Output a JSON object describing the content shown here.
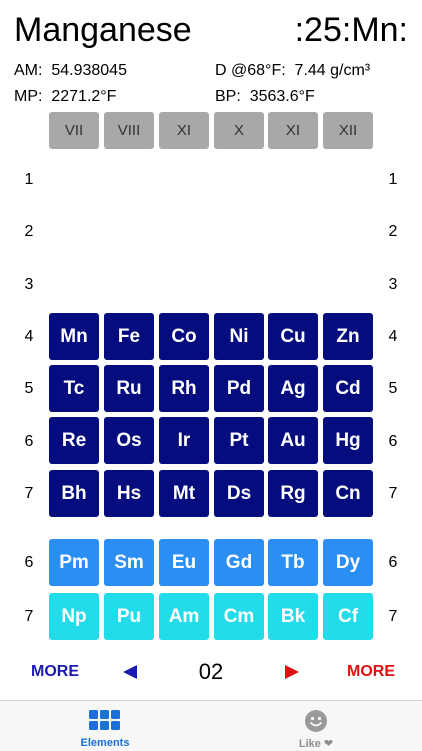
{
  "element": {
    "name": "Manganese",
    "symbol_display": ":25:Mn:",
    "am_label": "AM:",
    "am_value": "54.938045",
    "density_label": "D @68°F:",
    "density_value": "7.44 g/cm³",
    "mp_label": "MP:",
    "mp_value": "2271.2°F",
    "bp_label": "BP:",
    "bp_value": "3563.6°F"
  },
  "groups": [
    "VII",
    "VIII",
    "XI",
    "X",
    "XI",
    "XII"
  ],
  "periods": [
    "1",
    "2",
    "3",
    "4",
    "5",
    "6",
    "7"
  ],
  "lower_periods": [
    "6",
    "7"
  ],
  "main_rows": [
    [
      "Mn",
      "Fe",
      "Co",
      "Ni",
      "Cu",
      "Zn"
    ],
    [
      "Tc",
      "Ru",
      "Rh",
      "Pd",
      "Ag",
      "Cd"
    ],
    [
      "Re",
      "Os",
      "Ir",
      "Pt",
      "Au",
      "Hg"
    ],
    [
      "Bh",
      "Hs",
      "Mt",
      "Ds",
      "Rg",
      "Cn"
    ]
  ],
  "lanthanides": [
    "Pm",
    "Sm",
    "Eu",
    "Gd",
    "Tb",
    "Dy"
  ],
  "actinides": [
    "Np",
    "Pu",
    "Am",
    "Cm",
    "Bk",
    "Cf"
  ],
  "nav": {
    "more_left": "MORE",
    "more_right": "MORE",
    "page": "02"
  },
  "tabs": {
    "elements": "Elements",
    "like": "Like ❤"
  },
  "icons": [
    "grid-icon",
    "smiley-icon",
    "left-arrow-icon",
    "right-arrow-icon"
  ],
  "colors": {
    "transition_metals": "#050c7e",
    "lanthanides": "#2b8ef2",
    "actinides": "#23dcea",
    "group_header": "#a8a8a8",
    "more_left": "#1a1ab0",
    "more_right": "#e01010",
    "tab_active": "#1a6fd8",
    "tab_inactive": "#8e8e93"
  }
}
